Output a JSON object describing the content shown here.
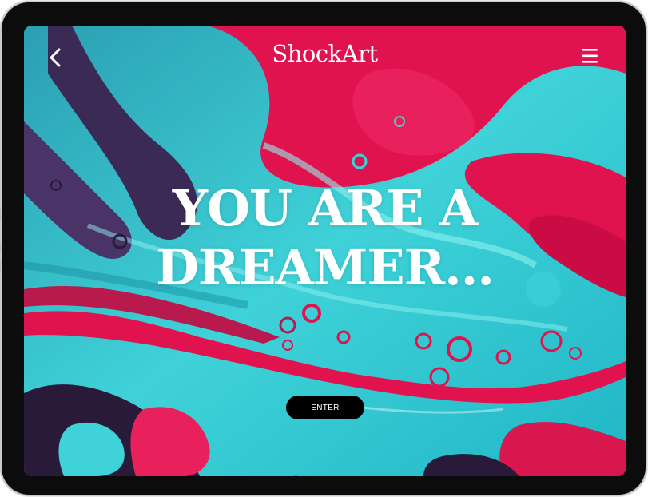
{
  "app": {
    "logo_text": "ShockArt"
  },
  "header": {
    "back_icon": "chevron-left-icon",
    "menu_icon": "hamburger-menu-icon"
  },
  "hero": {
    "headline_line1": "YOU ARE A",
    "headline_line2": "DREAMER..."
  },
  "cta": {
    "enter_label": "ENTER"
  },
  "colors": {
    "background_art_primary": "#25b8c4",
    "background_art_accent": "#e0134f",
    "background_art_dark": "#2a1a3a",
    "text": "#ffffff",
    "button_bg": "#000000",
    "device_frame": "#0c0c0c"
  }
}
